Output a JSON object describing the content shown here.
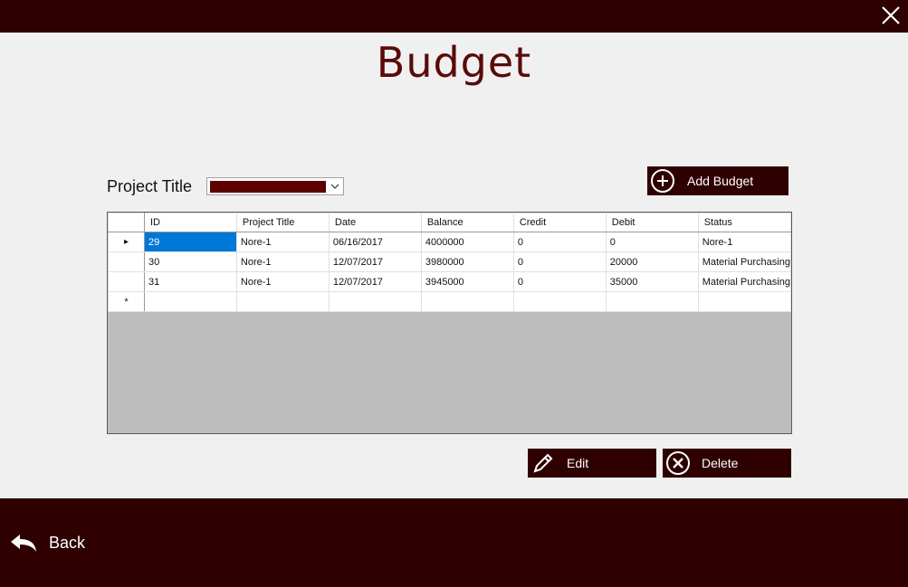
{
  "window": {
    "close_icon": "close-icon"
  },
  "page": {
    "title": "Budget"
  },
  "filter": {
    "label": "Project Title",
    "selected_value": "",
    "select_fill_color": "#5e0000"
  },
  "buttons": {
    "add_label": "Add Budget",
    "edit_label": "Edit",
    "delete_label": "Delete",
    "back_label": "Back"
  },
  "colors": {
    "bar": "#2e0000",
    "title": "#5a0a0a",
    "selection": "#0078d7",
    "empty_grid": "#bdbdbd"
  },
  "table": {
    "columns": [
      "ID",
      "Project Title",
      "Date",
      "Balance",
      "Credit",
      "Debit",
      "Status"
    ],
    "rows": [
      [
        "29",
        "Nore-1",
        "06/16/2017",
        "4000000",
        "0",
        "0",
        "Nore-1"
      ],
      [
        "30",
        "Nore-1",
        "12/07/2017",
        "3980000",
        "0",
        "20000",
        "Material Purchasing"
      ],
      [
        "31",
        "Nore-1",
        "12/07/2017",
        "3945000",
        "0",
        "35000",
        "Material Purchasing"
      ]
    ],
    "current_row_marker": "▸",
    "new_row_marker": "*"
  }
}
